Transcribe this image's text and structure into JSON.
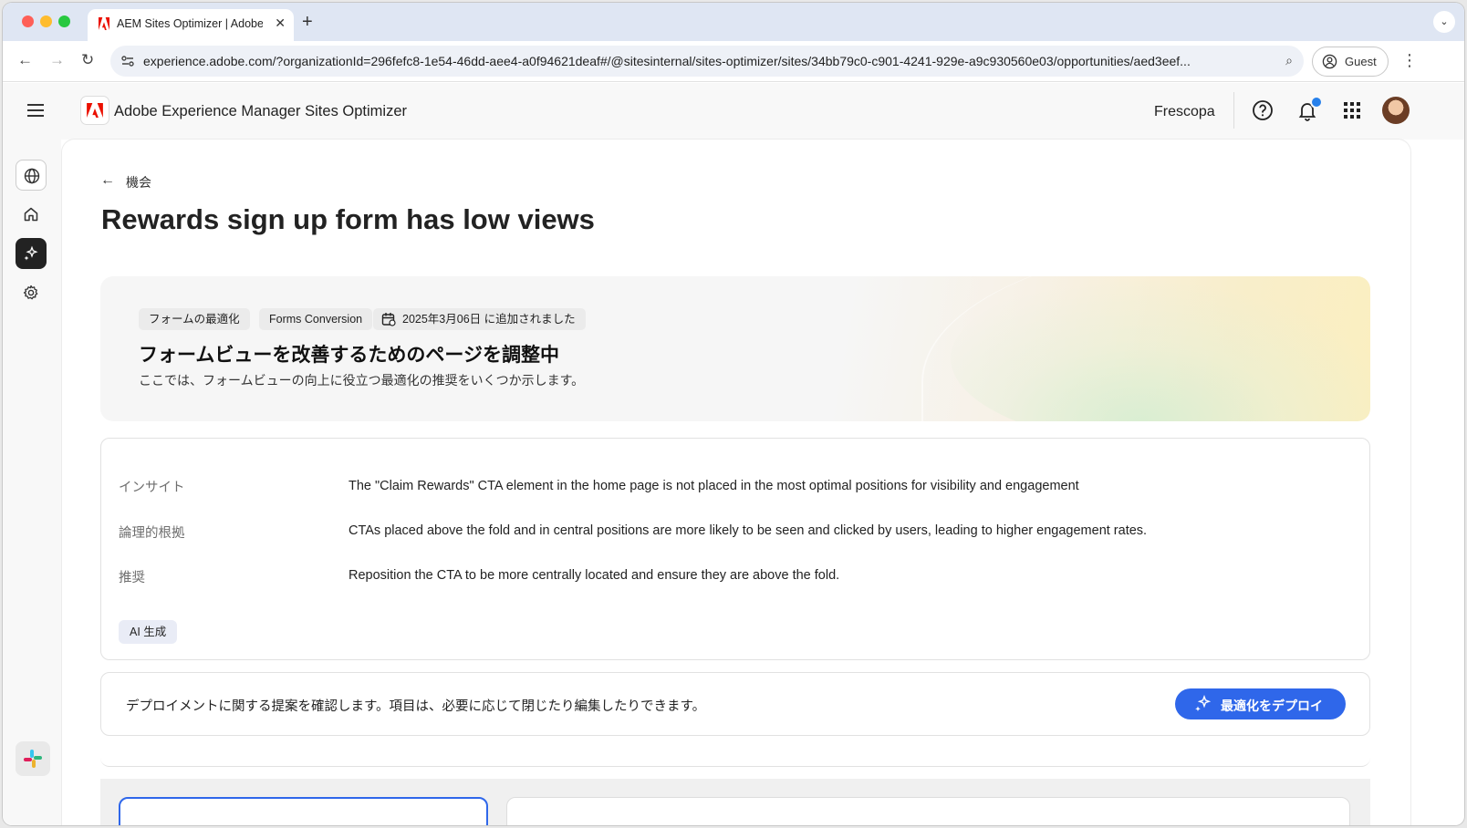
{
  "browser": {
    "tab_title": "AEM Sites Optimizer | Adobe",
    "url": "experience.adobe.com/?organizationId=296fefc8-1e54-46dd-aee4-a0f94621deaf#/@sitesinternal/sites-optimizer/sites/34bb79c0-c901-4241-929e-a9c930560e03/opportunities/aed3eef...",
    "profile_label": "Guest"
  },
  "app": {
    "title": "Adobe Experience Manager Sites Optimizer",
    "org_name": "Frescopa"
  },
  "page": {
    "back_label": "機会",
    "title": "Rewards sign up form has low views"
  },
  "hero": {
    "tags": [
      "フォームの最適化",
      "Forms Conversion"
    ],
    "date_label": "2025年3月06日 に追加されました",
    "title": "フォームビューを改善するためのページを調整中",
    "subtitle": "ここでは、フォームビューの向上に役立つ最適化の推奨をいくつか示します。"
  },
  "insight": {
    "rows": [
      {
        "label": "インサイト",
        "value": "The \"Claim Rewards\" CTA element in the home page is not placed in the most optimal positions for visibility and engagement"
      },
      {
        "label": "論理的根拠",
        "value": "CTAs placed above the fold and in central positions are more likely to be seen and clicked by users, leading to higher engagement rates."
      },
      {
        "label": "推奨",
        "value": "Reposition the CTA to be more centrally located and ensure they are above the fold."
      }
    ],
    "ai_badge": "AI 生成"
  },
  "deploy": {
    "text": "デプロイメントに関する提案を確認します。項目は、必要に応じて閉じたり編集したりできます。",
    "button_label": "最適化をデプロイ"
  },
  "colors": {
    "accent": "#2f67ea",
    "adobe_red": "#eb1000",
    "notification": "#2680eb"
  }
}
